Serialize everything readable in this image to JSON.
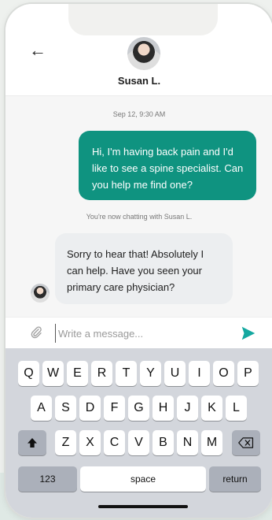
{
  "header": {
    "back_icon": "arrow-left-icon",
    "contact_name": "Susan L."
  },
  "chat": {
    "timestamp": "Sep 12, 9:30 AM",
    "outgoing_message": "Hi, I'm having back pain and I'd like to see a spine specialist. Can you help me find one?",
    "system_notice": "You're now chatting with Susan L.",
    "incoming_message": "Sorry to hear that! Absolutely I can help. Have you seen your primary care physician?"
  },
  "composer": {
    "placeholder": "Write a message...",
    "attach_icon": "paperclip-icon",
    "send_icon": "send-icon"
  },
  "keyboard": {
    "row1": [
      "Q",
      "W",
      "E",
      "R",
      "T",
      "Y",
      "U",
      "I",
      "O",
      "P"
    ],
    "row2": [
      "A",
      "S",
      "D",
      "F",
      "G",
      "H",
      "J",
      "K",
      "L"
    ],
    "row3": [
      "Z",
      "X",
      "C",
      "V",
      "B",
      "N",
      "M"
    ],
    "numbers_label": "123",
    "space_label": "space",
    "return_label": "return",
    "shift_icon": "shift-icon",
    "backspace_icon": "backspace-icon"
  },
  "colors": {
    "accent": "#0f9380",
    "send": "#14a8a0"
  }
}
